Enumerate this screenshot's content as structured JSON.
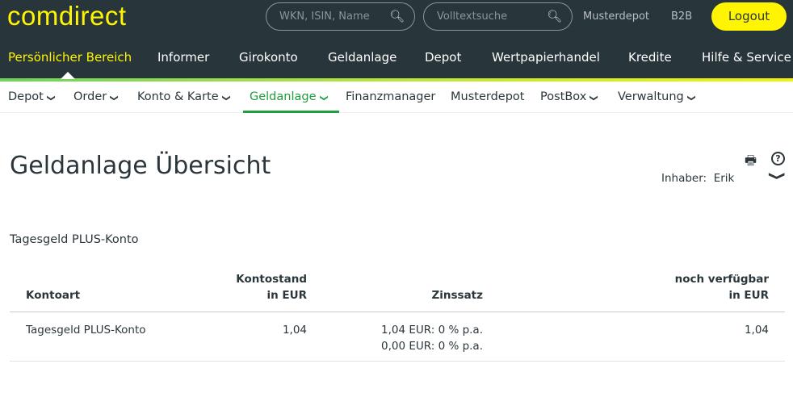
{
  "header": {
    "logo": "comdirect",
    "search1_placeholder": "WKN, ISIN, Name",
    "search2_placeholder": "Volltextsuche",
    "links": [
      "Musterdepot",
      "B2B"
    ],
    "logout": "Logout"
  },
  "main_nav": [
    "Persönlicher Bereich",
    "Informer",
    "Girokonto",
    "Geldanlage",
    "Depot",
    "Wertpapierhandel",
    "Kredite",
    "Hilfe & Service"
  ],
  "sub_nav": [
    {
      "label": "Depot"
    },
    {
      "label": "Order"
    },
    {
      "label": "Konto & Karte"
    },
    {
      "label": "Geldanlage"
    },
    {
      "label": "Finanzmanager"
    },
    {
      "label": "Musterdepot"
    },
    {
      "label": "PostBox"
    },
    {
      "label": "Verwaltung"
    }
  ],
  "page": {
    "title": "Geldanlage Übersicht",
    "owner_label": "Inhaber:",
    "owner": "Erik",
    "section": "Tagesgeld PLUS-Konto"
  },
  "table": {
    "headers": [
      "Kontoart",
      "Kontostand\nin EUR",
      "Zinssatz",
      "noch verfügbar\nin EUR"
    ],
    "rows": [
      {
        "kontoart": "Tagesgeld PLUS-Konto",
        "kontostand": "1,04",
        "zins1": "1,04 EUR: 0 % p.a.",
        "zins2": "0,00 EUR: 0 % p.a.",
        "verfuegbar": "1,04"
      }
    ]
  },
  "colors": {
    "header_bg": "#28353a",
    "brand_yellow": "#fff500",
    "active_green": "#1e9e3e"
  }
}
